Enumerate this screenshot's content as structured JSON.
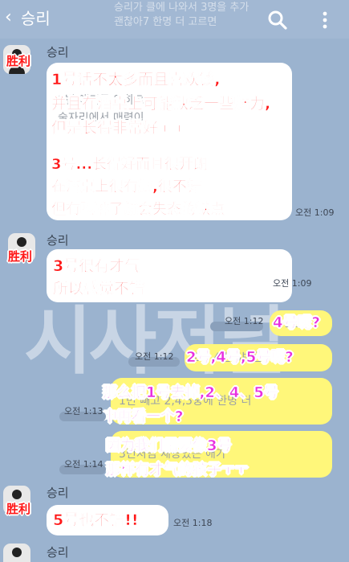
{
  "header": {
    "back_icon": "chevron-left-icon",
    "title": "승리",
    "bg_text_1": "승리가 클에 나와서 3명을 추가",
    "bg_text_2": "괜찮아7 한명 더 고르면",
    "search_icon": "search-icon",
    "more_icon": "more-vertical-icon"
  },
  "watermark": "시사저널",
  "messages": [
    {
      "sender": "승리",
      "tag": "胜利",
      "faint_1": "1번 얘기를 안하고",
      "faint_2": "술자리에서 매력이",
      "overlay_lines": [
        "1号话不太多而且喜欢钱,",
        "并且在酒桌上可能缺乏一些魅力,",
        "但是长得非常好ㅜㅜ"
      ],
      "overlay_lines_b": [
        "3号...长得好而且很开朗",
        "在酒桌上很有趣,很不错",
        "但有喝醉了就会失态的缺点"
      ],
      "time": "오전 1:09"
    },
    {
      "sender": "승리",
      "tag": "胜利",
      "overlay_lines": [
        "3号很有才气",
        "所以感觉不错"
      ],
      "time": "오전 1:09"
    },
    {
      "faint": "4번은?",
      "overlay": "4号呢?",
      "time": "오전 1:12"
    },
    {
      "faint": "2번,4번,5번은?",
      "overlay": "2号,4号,5号呢?",
      "time": "오전 1:12"
    },
    {
      "faint": "1번 빼고 2,4,5중에 한명 더",
      "overlay_lines": [
        "那么把1号去掉,2、4、5号",
        "中再看一个?"
      ],
      "time": "오전 1:13"
    },
    {
      "faint": "3번처럼 재능있는 애가",
      "overlay_lines": [
        "因为我们需要像3号",
        "那样有才气的孩子ㅜㅜ"
      ],
      "time": "오전 1:14"
    },
    {
      "sender": "승리",
      "tag": "胜利",
      "overlay": "5号也不错!!",
      "time": "오전 1:18"
    },
    {
      "sender": "승리"
    }
  ]
}
